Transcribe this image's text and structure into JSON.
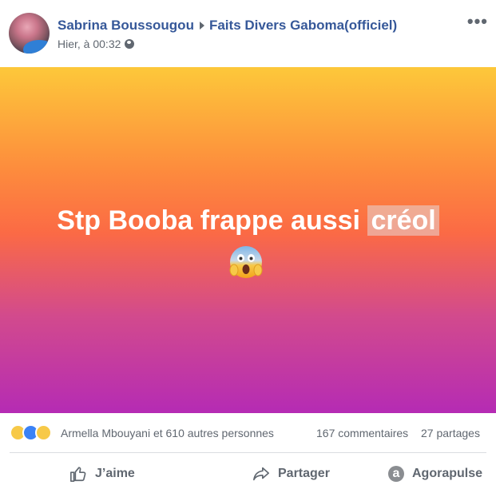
{
  "post": {
    "author": "Sabrina Boussougou",
    "group": "Faits Divers Gaboma(officiel)",
    "timestamp": "Hier, à 00:32",
    "audience_icon": "globe-icon",
    "more_icon": "ellipsis-icon",
    "more_symbol": "•••"
  },
  "content": {
    "text_main": "Stp Booba frappe aussi ",
    "text_highlight": "créol",
    "emoji": "face-screaming-in-fear-emoji",
    "gradient_colors": [
      "#fdc83a",
      "#fd8b3d",
      "#fb6a45",
      "#d24a8d",
      "#b52bb4"
    ]
  },
  "reactions": {
    "icons": [
      "haha-icon",
      "like-icon",
      "wow-icon"
    ],
    "names": "Armella Mbouyani et 610 autres personnes",
    "comments": "167 commentaires",
    "shares": "27 partages"
  },
  "actions": {
    "like_label": "J’aime",
    "share_label": "Partager",
    "agora_label": "Agorapulse",
    "agora_letter": "a"
  },
  "colors": {
    "link": "#365899",
    "secondary": "#606770",
    "like_blue": "#3b82f6"
  }
}
